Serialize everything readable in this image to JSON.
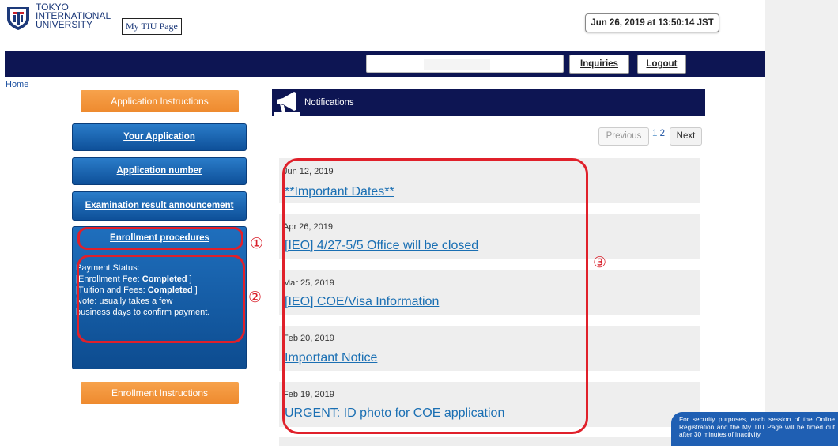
{
  "header": {
    "univ_line1": "TOKYO",
    "univ_line2": "INTERNATIONAL",
    "univ_line3": "UNIVERSITY",
    "my_page_label": "My TIU Page",
    "datetime": "Jun 26, 2019 at 13:50:14 JST"
  },
  "nav": {
    "inquiries_label": "Inquiries",
    "logout_label": "Logout"
  },
  "breadcrumb": {
    "home": "Home"
  },
  "sidebar": {
    "application_instructions": "Application Instructions",
    "your_application": "Your Application",
    "application_number": "Application number",
    "exam_result": "Examination result announcement",
    "enrollment_procedures": "Enrollment procedures",
    "payment": {
      "status_label": "Payment Status:",
      "enrollment_fee_label": "[Enrollment Fee: ",
      "enrollment_fee_value": "Completed",
      "tuition_label": "[Tuition and Fees: ",
      "tuition_value": "Completed",
      "close_bracket": " ]",
      "note_line1": "Note: usually takes a few",
      "note_line2": "business days to confirm payment."
    },
    "enrollment_instructions": "Enrollment Instructions"
  },
  "notifications": {
    "title": "Notifications",
    "pagination": {
      "previous": "Previous",
      "page1": "1",
      "page2": "2",
      "next": "Next"
    },
    "items": [
      {
        "date": "Jun 12, 2019",
        "title": "**Important Dates**"
      },
      {
        "date": "Apr 26, 2019",
        "title": "[IEO] 4/27-5/5 Office will be closed"
      },
      {
        "date": "Mar 25, 2019",
        "title": "[IEO] COE/Visa Information"
      },
      {
        "date": "Feb 20, 2019",
        "title": "Important Notice"
      },
      {
        "date": "Feb 19, 2019",
        "title": "URGENT: ID photo for COE application"
      }
    ]
  },
  "annotations": {
    "one": "①",
    "two": "②",
    "three": "③"
  },
  "session_notice": "For security purposes, each session of the Online Registration and the My TIU Page will be timed out after 30 minutes of inactivity.",
  "colors": {
    "navy": "#0d1553",
    "blue_button": "#1a62b0",
    "orange_button": "#f09232",
    "link": "#1a6fb3",
    "annotation_red": "#e0202a"
  }
}
